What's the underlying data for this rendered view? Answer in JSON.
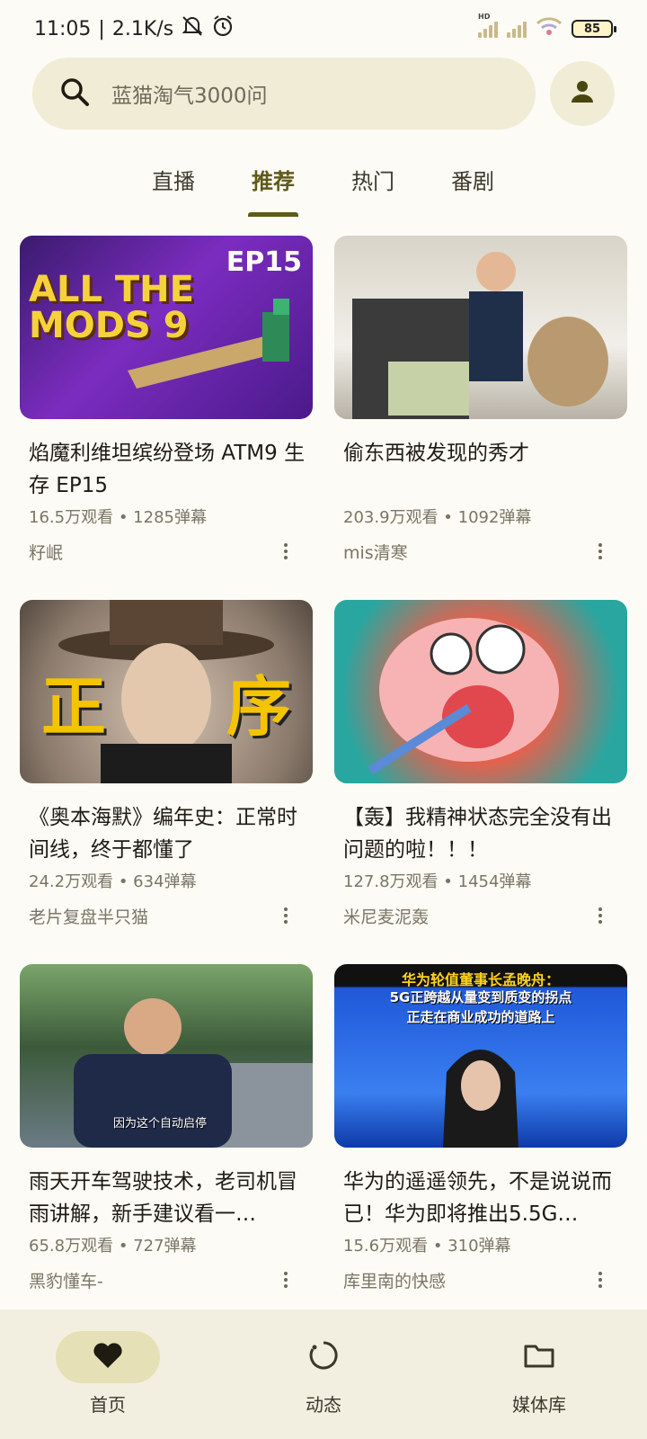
{
  "status_bar": {
    "time": "11:05",
    "network_speed": "2.1K/s",
    "battery": "85"
  },
  "search": {
    "placeholder": "蓝猫淘气3000问"
  },
  "tabs": [
    {
      "label": "直播",
      "active": false
    },
    {
      "label": "推荐",
      "active": true
    },
    {
      "label": "热门",
      "active": false
    },
    {
      "label": "番剧",
      "active": false
    }
  ],
  "videos": [
    {
      "title": "焰魔利维坦缤纷登场 ATM9 生存 EP15",
      "views": "16.5万观看",
      "danmaku": "1285弹幕",
      "author": "籽岷",
      "thumb_text": [
        "ALL THE MODS 9",
        "EP15"
      ]
    },
    {
      "title": "偷东西被发现的秀才",
      "views": "203.9万观看",
      "danmaku": "1092弹幕",
      "author": "mis清寒",
      "thumb_text": []
    },
    {
      "title": "《奥本海默》编年史：正常时间线，终于都懂了",
      "views": "24.2万观看",
      "danmaku": "634弹幕",
      "author": "老片复盘半只猫",
      "thumb_text": [
        "正",
        "序"
      ]
    },
    {
      "title": "【轰】我精神状态完全没有出问题的啦！！！",
      "views": "127.8万观看",
      "danmaku": "1454弹幕",
      "author": "米尼麦泥轰",
      "thumb_text": []
    },
    {
      "title": "雨天开车驾驶技术，老司机冒雨讲解，新手建议看一…",
      "views": "65.8万观看",
      "danmaku": "727弹幕",
      "author": "黑豹懂车-",
      "thumb_text": [
        "因为这个自动启停"
      ]
    },
    {
      "title": "华为的遥遥领先，不是说说而已！华为即将推出5.5G…",
      "views": "15.6万观看",
      "danmaku": "310弹幕",
      "author": "库里南的快感",
      "thumb_text": [
        "华为轮值董事长孟晚舟：",
        "5G正跨越从量变到质变的拐点",
        "正走在商业成功的道路上"
      ]
    }
  ],
  "separator": "•",
  "bottom_nav": [
    {
      "label": "首页",
      "icon": "heart-icon",
      "active": true
    },
    {
      "label": "动态",
      "icon": "refresh-circle-icon",
      "active": false
    },
    {
      "label": "媒体库",
      "icon": "folder-icon",
      "active": false
    }
  ],
  "colors": {
    "background": "#fdfbf5",
    "accent": "#5f5a1a",
    "search_bg": "#f0ecd6",
    "nav_active": "#e6e0b6"
  }
}
